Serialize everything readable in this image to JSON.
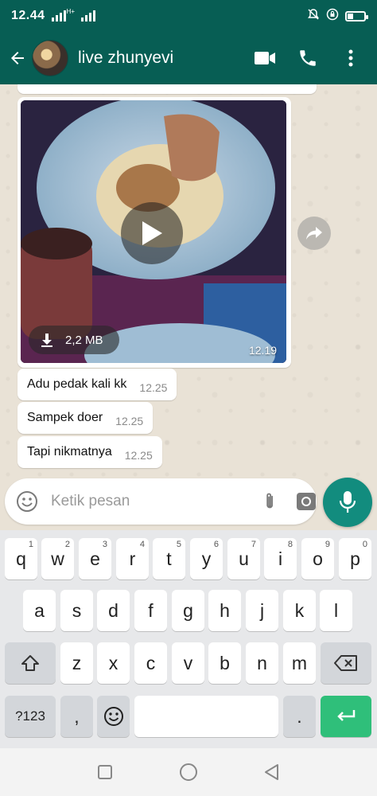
{
  "status_bar": {
    "time": "12.44",
    "network": "H+"
  },
  "header": {
    "contact_name": "live zhunyevi"
  },
  "video_message": {
    "size": "2,2 MB",
    "time": "12.19"
  },
  "messages": [
    {
      "text": "Adu pedak kali kk",
      "time": "12.25"
    },
    {
      "text": "Sampek doer",
      "time": "12.25"
    },
    {
      "text": "Tapi nikmatnya",
      "time": "12.25"
    }
  ],
  "composer": {
    "placeholder": "Ketik pesan"
  },
  "keyboard": {
    "row1": [
      {
        "k": "q",
        "n": "1"
      },
      {
        "k": "w",
        "n": "2"
      },
      {
        "k": "e",
        "n": "3"
      },
      {
        "k": "r",
        "n": "4"
      },
      {
        "k": "t",
        "n": "5"
      },
      {
        "k": "y",
        "n": "6"
      },
      {
        "k": "u",
        "n": "7"
      },
      {
        "k": "i",
        "n": "8"
      },
      {
        "k": "o",
        "n": "9"
      },
      {
        "k": "p",
        "n": "0"
      }
    ],
    "row2": [
      "a",
      "s",
      "d",
      "f",
      "g",
      "h",
      "j",
      "k",
      "l"
    ],
    "row3": [
      "z",
      "x",
      "c",
      "v",
      "b",
      "n",
      "m"
    ],
    "symbols_label": "?123",
    "comma": ",",
    "period": "."
  },
  "colors": {
    "header": "#075e54",
    "accent": "#128c7e",
    "enter": "#2fbf7a"
  }
}
